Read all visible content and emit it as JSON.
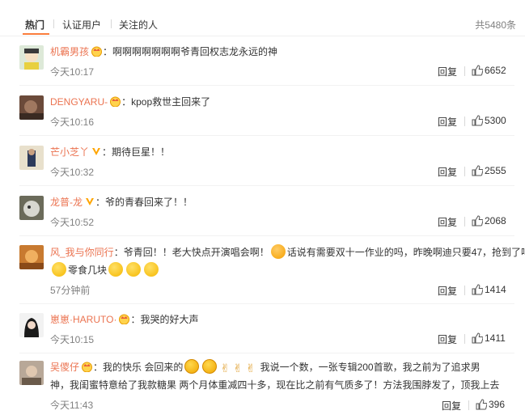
{
  "tabs": {
    "items": [
      "热门",
      "认证用户",
      "关注的人"
    ],
    "total": "共5480条"
  },
  "actions": {
    "reply_label": "回复"
  },
  "comments": [
    {
      "user": "机霸男孩",
      "text": "：啊啊啊啊啊啊啊爷青回权志龙永远的神",
      "time": "今天10:17",
      "likes": "6652",
      "badge": "crown"
    },
    {
      "user": "DENGYARU-",
      "text": "：kpop救世主回来了",
      "time": "今天10:16",
      "likes": "5300",
      "badge": "crown"
    },
    {
      "user": "芒小芝丫",
      "text": "：期待巨星！！",
      "time": "今天10:32",
      "likes": "2555",
      "badge": "v"
    },
    {
      "user": "龙普-龙",
      "text": "：爷的青春回来了！！",
      "time": "今天10:52",
      "likes": "2068",
      "badge": "v"
    },
    {
      "user": "风_我与你同行",
      "text": "：爷青回！！老大快点开演唱会啊！",
      "text2": "话说有需要双十一作业的吗，昨晚啊迪只要47，抢到了吗",
      "text3": "零食几块",
      "time": "57分钟前",
      "likes": "1414",
      "badge": "none"
    },
    {
      "user": "崽崽·HARUTO·",
      "text": "：我哭的好大声",
      "time": "今天10:15",
      "likes": "1411",
      "badge": "crown"
    },
    {
      "user": "吴儍仔",
      "text": "：我的快乐 会回来的",
      "text2": "我说一个数，一张专辑200首歌，我之前为了追求男",
      "text3": "神，我闺蜜特意给了我款糖果 两个月体重减四十多，现在比之前有气质多了！方法我围脖发了，顶我上去",
      "time": "今天11:43",
      "likes": "396",
      "badge": "crown"
    }
  ],
  "colors": {
    "username": "#eb7350",
    "accent": "#fa7d3c",
    "muted": "#808080"
  }
}
